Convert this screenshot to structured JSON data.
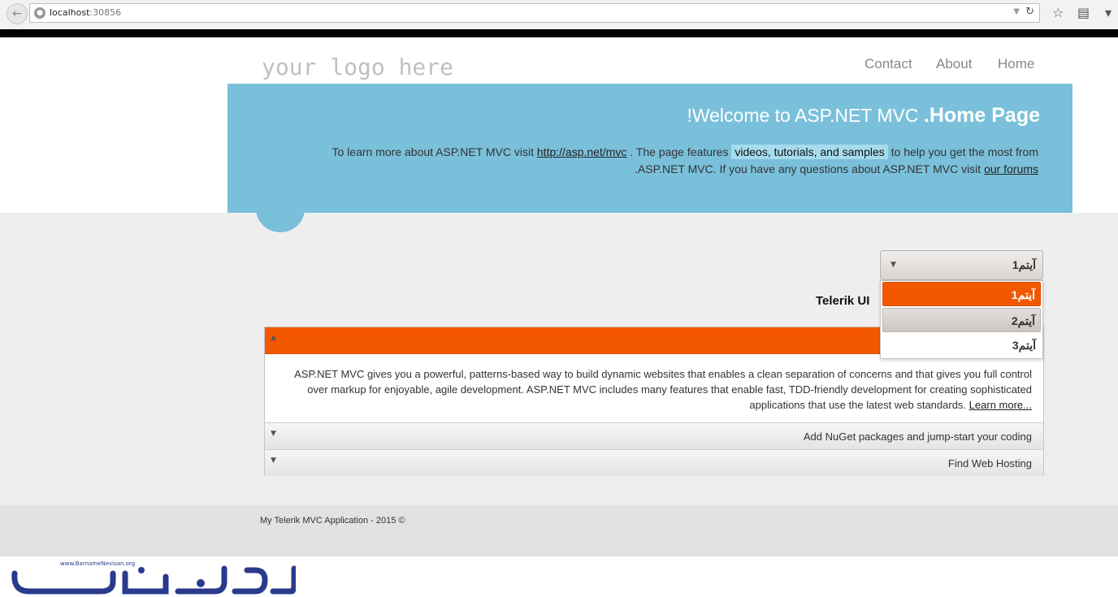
{
  "browser": {
    "url_host": "localhost",
    "url_port": ":30856"
  },
  "header": {
    "logo": "your logo here",
    "nav": [
      {
        "label": "Contact"
      },
      {
        "label": "About"
      },
      {
        "label": "Home"
      }
    ]
  },
  "featured": {
    "title_bold": ".Home Page",
    "title_rest": "!Welcome to ASP.NET MVC",
    "p_line1_a": "To learn more about ASP.NET MVC visit",
    "p_link1": "http://asp.net/mvc",
    "p_line1_b": ". The page features",
    "p_highlight": "videos, tutorials, and samples",
    "p_line1_c": "to help you get the most from",
    "p_line2_a": ".ASP.NET MVC. If you have any questions about ASP.NET MVC visit",
    "p_link2": "our forums"
  },
  "section": {
    "title": "Telerik UI",
    "trailing": "."
  },
  "panelbar": {
    "content": "ASP.NET MVC gives you a powerful, patterns-based way to build dynamic websites that enables a clean separation of concerns and that gives you full control over markup for enjoyable, agile development. ASP.NET MVC includes many features that enable fast, TDD-friendly development for creating sophisticated applications that use the latest web standards.",
    "learn_more": "Learn more...",
    "items": [
      {
        "label": "Add NuGet packages and jump-start your coding"
      },
      {
        "label": "Find Web Hosting"
      }
    ]
  },
  "dropdown": {
    "value": "آیتم1",
    "options": [
      {
        "label": "آیتم1"
      },
      {
        "label": "آیتم2"
      },
      {
        "label": "آیتم3"
      }
    ]
  },
  "footer": {
    "text": "My Telerik MVC Application - 2015 ©"
  },
  "watermark": {
    "site": "www.BarnameNevisan.org"
  },
  "colors": {
    "accent": "#f35800",
    "featured": "#7ac0da",
    "main_bg": "#efeeef"
  }
}
